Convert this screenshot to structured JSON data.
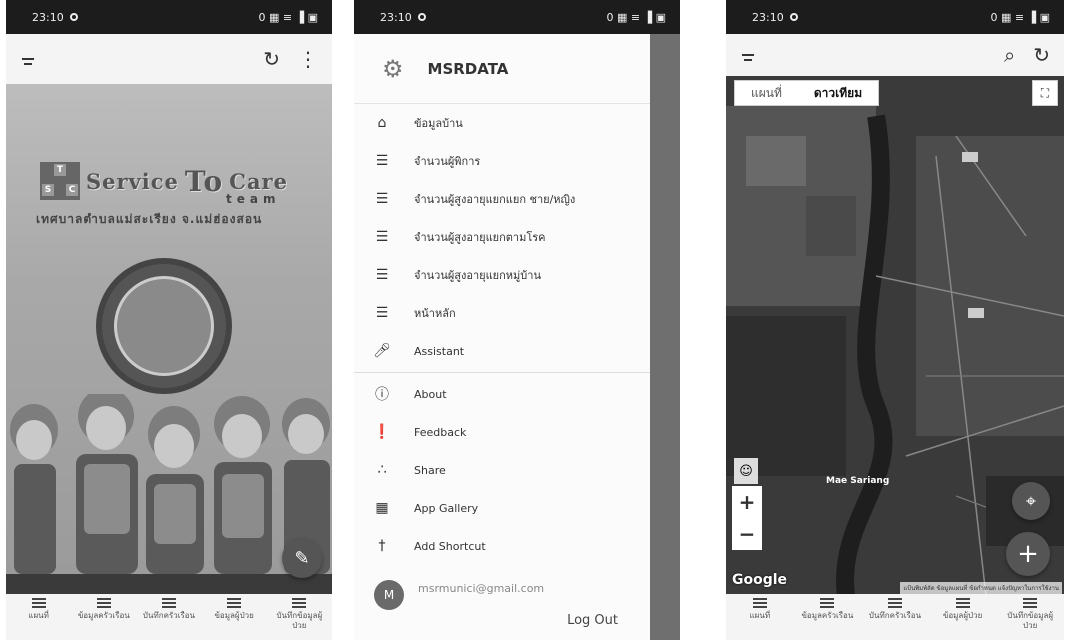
{
  "status": {
    "time": "23:10",
    "right_icons": "0 ▦ ≡ ▐ ▣"
  },
  "screen1": {
    "brand_service": "Service",
    "brand_to": "To",
    "brand_care": "Care",
    "brand_team": "team",
    "brand_sub": "เทศบาลตำบลแม่สะเรียง จ.แม่ฮ่องสอน",
    "seal_text": "เทศบาลตำบลแม่สะเรียง",
    "fab_icon": "edit-icon"
  },
  "bottom_nav": [
    {
      "label": "แผนที่"
    },
    {
      "label": "ข้อมูลครัวเรือน"
    },
    {
      "label": "บันทึกครัวเรือน"
    },
    {
      "label": "ข้อมูลผู้ป่วย"
    },
    {
      "label": "บันทึกข้อมูลผู้ป่วย"
    }
  ],
  "drawer": {
    "title": "MSRDATA",
    "items": [
      {
        "label": "ข้อมูลบ้าน",
        "icon": "home-icon"
      },
      {
        "label": "จำนวนผู้พิการ",
        "icon": "list-icon"
      },
      {
        "label": "จำนวนผู้สูงอายุแยกแยก ชาย/หญิง",
        "icon": "list-icon"
      },
      {
        "label": "จำนวนผู้สูงอายุแยกตามโรค",
        "icon": "list-icon"
      },
      {
        "label": "จำนวนผู้สูงอายุแยกหมู่บ้าน",
        "icon": "list-icon"
      },
      {
        "label": "หน้าหลัก",
        "icon": "list-icon"
      },
      {
        "label": "Assistant",
        "icon": "mic-icon"
      }
    ],
    "items2": [
      {
        "label": "About",
        "icon": "info-icon"
      },
      {
        "label": "Feedback",
        "icon": "feedback-icon"
      },
      {
        "label": "Share",
        "icon": "share-icon"
      },
      {
        "label": "App Gallery",
        "icon": "gallery-icon"
      },
      {
        "label": "Add Shortcut",
        "icon": "pin-icon"
      }
    ],
    "avatar_letter": "M",
    "email": "msrmunici@gmail.com",
    "logout": "Log Out"
  },
  "map": {
    "tab_map": "แผนที่",
    "tab_satellite": "ดาวเทียม",
    "zoom_in": "+",
    "zoom_out": "−",
    "google": "Google",
    "attribution": "แป้นพิมพ์ลัด  ข้อมูลแผนที่  ข้อกำหนด  แจ้งปัญหาในการใช้งาน",
    "place_label": "Mae Sariang"
  }
}
